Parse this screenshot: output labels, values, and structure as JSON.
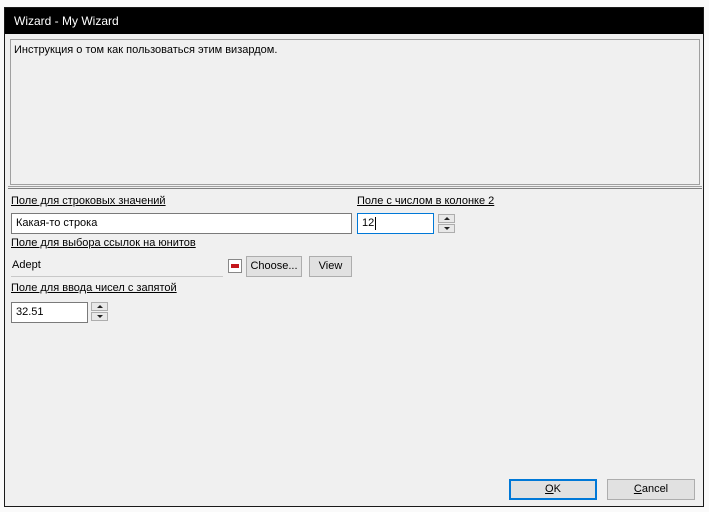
{
  "window": {
    "title": "Wizard - My Wizard"
  },
  "instructions": {
    "text": "Инструкция о том как пользоваться этим визардом."
  },
  "fields": {
    "string_field": {
      "label": "Поле для строковых значений",
      "value": "Какая-то строка"
    },
    "number_col2": {
      "label": "Поле с числом в колонке 2",
      "value": "12"
    },
    "unit_ref": {
      "label": "Поле для выбора ссылок на юнитов",
      "value": "Adept",
      "choose_label": "Choose...",
      "view_label": "View"
    },
    "decimal_field": {
      "label": "Поле для ввода чисел с запятой",
      "value": "32.51"
    }
  },
  "buttons": {
    "ok": {
      "accel": "O",
      "rest": "K"
    },
    "cancel": {
      "accel": "C",
      "rest": "ancel"
    }
  },
  "colors": {
    "focus": "#0078d7",
    "unit_marker": "#c4161c",
    "titlebar": "#000000"
  },
  "icons": [
    "spin-up-icon",
    "spin-down-icon",
    "unit-color-icon"
  ]
}
